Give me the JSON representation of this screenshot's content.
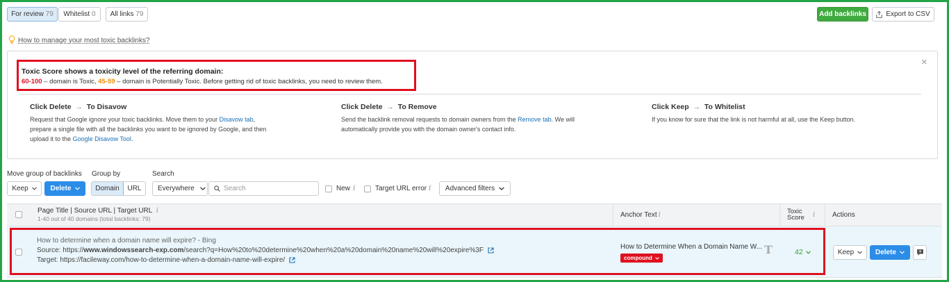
{
  "tabs": [
    {
      "label": "For review",
      "count": "79"
    },
    {
      "label": "Whitelist",
      "count": "0"
    },
    {
      "label": "All links",
      "count": "79"
    }
  ],
  "top_actions": {
    "add_backlinks": "Add backlinks",
    "export_csv": "Export to CSV"
  },
  "help_link": "How to manage your most toxic backlinks?",
  "info_panel": {
    "title": "Toxic Score shows a toxicity level of the referring domain:",
    "range_toxic": "60-100",
    "text_toxic": " – domain is Toxic, ",
    "range_potential": "45-59",
    "text_potential": " – domain is Potentially Toxic. Before getting rid of toxic backlinks, you need to review them.",
    "close": "×",
    "columns": [
      {
        "action": "Click Delete",
        "arrow": "→",
        "target": "To Disavow",
        "line1_pre": "Request that Google ignore your toxic backlinks. Move them to your ",
        "line1_link": "Disavow tab",
        "line1_post": ",",
        "line2": "prepare a single file with all the backlinks you want to be ignored by Google, and then",
        "line3_pre": "upload it to the ",
        "line3_link": "Google Disavow Tool",
        "line3_post": "."
      },
      {
        "action": "Click Delete",
        "arrow": "→",
        "target": "To Remove",
        "line1_pre": "Send the backlink removal requests to domain owners from the ",
        "line1_link": "Remove tab",
        "line1_post": ". We will",
        "line2": "automatically provide you with the domain owner's contact info."
      },
      {
        "action": "Click Keep",
        "arrow": "→",
        "target": "To Whitelist",
        "line1": "If you know for sure that the link is not harmful at all, use the Keep button."
      }
    ]
  },
  "filters": {
    "move_group_label": "Move group of backlinks",
    "keep": "Keep",
    "delete": "Delete",
    "group_by_label": "Group by",
    "group_domain": "Domain",
    "group_url": "URL",
    "search_label": "Search",
    "search_scope": "Everywhere",
    "search_placeholder": "Search",
    "new_label": "New",
    "target_url_error_label": "Target URL error",
    "advanced_filters": "Advanced filters",
    "info_glyph": "i"
  },
  "table": {
    "header": {
      "page_title": "Page Title | Source URL | Target URL",
      "subtitle": "1-40 out of 40 domains (total backlinks: 79)",
      "anchor_text": "Anchor Text",
      "toxic_score_line1": "Toxic",
      "toxic_score_line2": "Score",
      "actions": "Actions"
    },
    "rows": [
      {
        "page_title": "How to determine when a domain name will expire? - Bing",
        "source_label": "Source: ",
        "source_prefix": "https://",
        "source_domain": "www.windowssearch-exp.com",
        "source_path": "/search?q=How%20to%20determine%20when%20a%20domain%20name%20will%20expire%3F",
        "target_label": "Target: ",
        "target_url": "https://facileway.com/how-to-determine-when-a-domain-name-will-expire/",
        "anchor_text": "How to Determine When a Domain Name W...",
        "anchor_type_glyph": "T",
        "tag": "compound",
        "toxic_score": "42",
        "keep": "Keep",
        "delete": "Delete"
      }
    ]
  },
  "colors": {
    "green_border": "#22a447",
    "red_highlight": "#e0101f",
    "primary_blue": "#2b8de8",
    "add_green": "#3faa3f",
    "toxic_red": "#e0101f",
    "potential_orange": "#f08a00",
    "score_green": "#3a9a3a",
    "row_bg": "#eaf6fb"
  }
}
